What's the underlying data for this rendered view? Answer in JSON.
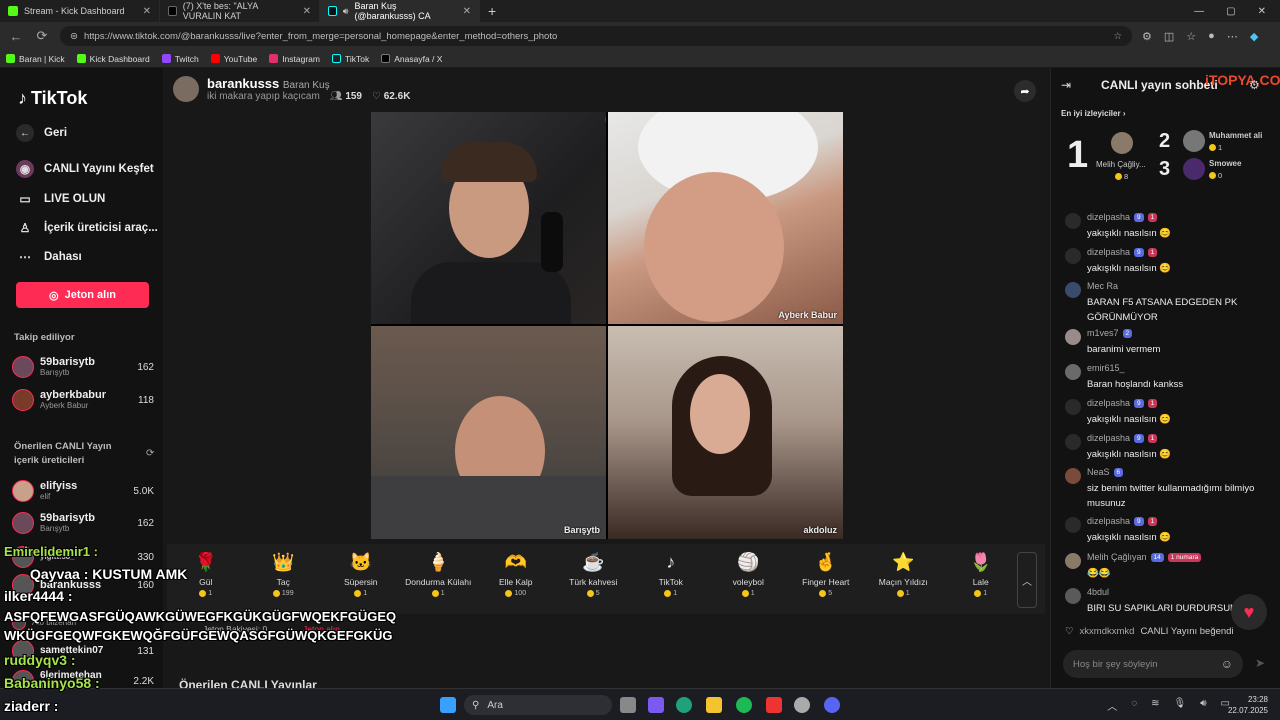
{
  "browser": {
    "tabs": [
      {
        "label": "Stream - Kick Dashboard",
        "color": "#53fc18"
      },
      {
        "label": "(7) X'te bes: \"ALYA VURALIN KAT",
        "color": "#ffffff"
      },
      {
        "label": "Baran Kuş (@barankusss) CA",
        "color": "#ffffff"
      }
    ],
    "url": "https://www.tiktok.com/@barankusss/live?enter_from_merge=personal_homepage&enter_method=others_photo",
    "bookmarks": [
      {
        "label": "Baran | Kick",
        "color": "#53fc18"
      },
      {
        "label": "Kick Dashboard",
        "color": "#53fc18"
      },
      {
        "label": "Twitch",
        "color": "#9146ff"
      },
      {
        "label": "YouTube",
        "color": "#ff0000"
      },
      {
        "label": "Instagram",
        "color": "#e1306c"
      },
      {
        "label": "TikTok",
        "color": "#222222"
      },
      {
        "label": "Anasayfa / X",
        "color": "#000000"
      }
    ]
  },
  "sidebar": {
    "logo": "TikTok",
    "nav": [
      {
        "label": "Geri",
        "icon": "back-arrow-icon"
      },
      {
        "label": "CANLI Yayını Keşfet",
        "icon": "live-explore-icon"
      },
      {
        "label": "LIVE OLUN",
        "icon": "camera-icon"
      },
      {
        "label": "İçerik üreticisi araç...",
        "icon": "creator-tools-icon"
      },
      {
        "label": "Dahası",
        "icon": "more-dots-icon"
      }
    ],
    "coin_button": "Jeton alın",
    "following_title": "Takip ediliyor",
    "following": [
      {
        "name": "59barisytb",
        "sub": "Barışytb",
        "count": "162"
      },
      {
        "name": "ayberkbabur",
        "sub": "Ayberk Babur",
        "count": "118"
      }
    ],
    "suggested_title": "Önerilen CANLI Yayın içerik üreticileri",
    "suggested": [
      {
        "name": "elifyiss",
        "sub": "elif",
        "count": "5.0K"
      },
      {
        "name": "59barisytb",
        "sub": "Barışytb",
        "count": "162"
      },
      {
        "name": "yigitt.58_",
        "sub": "",
        "count": "330"
      },
      {
        "name": "barankusss",
        "sub": "",
        "count": "160"
      },
      {
        "name": "Ato bilzerian",
        "sub": "",
        "count": ""
      },
      {
        "name": "samettekin07",
        "sub": "",
        "count": "131"
      },
      {
        "name": "6lerimetehan",
        "sub": "TRY.EUR",
        "count": "2.2K"
      }
    ]
  },
  "stream": {
    "username": "barankusss",
    "display": "Baran Kuş",
    "subtitle": "iki makara yapıp kaçıcam",
    "viewers": "159",
    "likes": "62.6K",
    "participants": [
      {
        "label": ""
      },
      {
        "label": "Ayberk Babur"
      },
      {
        "label": "Barışytb"
      },
      {
        "label": "akdoluz"
      }
    ],
    "gifts": [
      {
        "name": "Gül",
        "price": "1",
        "icon": "rose-icon",
        "glyph": "🌹"
      },
      {
        "name": "Taç",
        "price": "199",
        "icon": "crown-icon",
        "glyph": "👑"
      },
      {
        "name": "Süpersin",
        "price": "1",
        "icon": "cat-icon",
        "glyph": "🐱"
      },
      {
        "name": "Dondurma Külahı",
        "price": "1",
        "icon": "ice-cream-icon",
        "glyph": "🍦"
      },
      {
        "name": "Elle Kalp",
        "price": "100",
        "icon": "hand-heart-icon",
        "glyph": "🫶"
      },
      {
        "name": "Türk kahvesi",
        "price": "5",
        "icon": "coffee-icon",
        "glyph": "☕"
      },
      {
        "name": "TikTok",
        "price": "1",
        "icon": "tiktok-icon",
        "glyph": "♪"
      },
      {
        "name": "voleybol",
        "price": "1",
        "icon": "volleyball-icon",
        "glyph": "🏐"
      },
      {
        "name": "Finger Heart",
        "price": "5",
        "icon": "finger-heart-icon",
        "glyph": "🤞"
      },
      {
        "name": "Maçın Yıldızı",
        "price": "1",
        "icon": "star-icon",
        "glyph": "⭐"
      },
      {
        "name": "Lale",
        "price": "1",
        "icon": "tulip-icon",
        "glyph": "🌷"
      }
    ],
    "coin_balance": "Jeton Bakiyesi: 0",
    "coin_buy": "Jeton alın",
    "suggested_live": "Önerilen CANLI Yayınlar"
  },
  "chat": {
    "title": "CANLI yayın sohbeti",
    "watermark": "iTOPYA.COM",
    "top_viewers": "En iyi izleyiciler",
    "ranks": [
      {
        "rank": "1",
        "name": "Melih Çağliy...",
        "count": "8"
      },
      {
        "rank": "2",
        "name": "Muhammet ali",
        "count": "1"
      },
      {
        "rank": "3",
        "name": "Smowee",
        "count": "0"
      }
    ],
    "messages": [
      {
        "user": "dizelpasha",
        "badges": [
          "9",
          "1"
        ],
        "text": "yakışıklı nasılsın 😊"
      },
      {
        "user": "dizelpasha",
        "badges": [
          "9",
          "1"
        ],
        "text": "yakışıklı nasılsın 😊"
      },
      {
        "user": "Mec Ra",
        "badges": [],
        "text": "BARAN F5 ATSANA EDGEDEN PK GÖRÜNMÜYOR"
      },
      {
        "user": "m1ves7",
        "badges": [
          "2"
        ],
        "text": "baranimi vermem"
      },
      {
        "user": "emir615_",
        "badges": [],
        "text": "Baran hoşlandı kankss"
      },
      {
        "user": "dizelpasha",
        "badges": [
          "9",
          "1"
        ],
        "text": "yakışıklı nasılsın 😊"
      },
      {
        "user": "dizelpasha",
        "badges": [
          "9",
          "1"
        ],
        "text": "yakışıklı nasılsın 😊"
      },
      {
        "user": "NeaS",
        "badges": [
          "6"
        ],
        "text": "siz benim twitter kullanmadığımı bilmiyo musunuz"
      },
      {
        "user": "dizelpasha",
        "badges": [
          "9",
          "1"
        ],
        "text": "yakışıklı nasılsın 😊"
      },
      {
        "user": "Melih Çağlıyan",
        "badges": [
          "14",
          "1 numara"
        ],
        "text": "😂😂"
      },
      {
        "user": "4bdul",
        "badges": [],
        "text": "BIRI SU SAPIKLARI DURDURSUN"
      }
    ],
    "liked_user": "xkxmdkxmkd",
    "liked_text": "CANLI Yayını beğendi",
    "input_placeholder": "Hoş bir şey söyleyin"
  },
  "overlay": [
    {
      "text": "Emirelidemir1 :",
      "green": true
    },
    {
      "text": "Qayvaa : KUSTUM AMK",
      "green": false
    },
    {
      "text": "ilker4444 :",
      "green": false
    },
    {
      "text": "ASFQFEWGASFGÜQAWKGÜWEGFKGÜKGÜGFWQEKFGÜGEQ",
      "green": false
    },
    {
      "text": "WKÜGFGEQWFGKEWQĞFGÜFGEWQASGFGÜWQKGEFGKÜG",
      "green": false
    },
    {
      "text": "ruddyqv3 :",
      "green": true
    },
    {
      "text": "Babaninyo58 :",
      "green": true
    },
    {
      "text": "ziaderr :",
      "green": false
    }
  ],
  "taskbar": {
    "search": "Ara",
    "time": "23:28",
    "date": "22.07.2025"
  }
}
